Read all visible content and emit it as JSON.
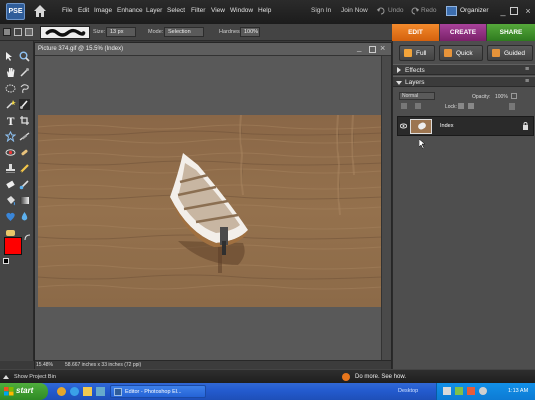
{
  "app": {
    "logo_text": "PSE"
  },
  "menu": [
    "File",
    "Edit",
    "Image",
    "Enhance",
    "Layer",
    "Select",
    "Filter",
    "View",
    "Window",
    "Help"
  ],
  "top_links": {
    "sign_in": "Sign In",
    "join_now": "Join Now",
    "undo": "Undo",
    "redo": "Redo",
    "organizer": "Organizer"
  },
  "options_bar": {
    "size_label": "Size:",
    "size_value": "13 px",
    "mode_label": "Mode:",
    "mode_value": "Selection",
    "hardness_label": "Hardness:",
    "hardness_value": "100%"
  },
  "mode_tabs": [
    {
      "label": "EDIT",
      "color": "#e2701b"
    },
    {
      "label": "CREATE",
      "color": "#8a2c7a"
    },
    {
      "label": "SHARE",
      "color": "#3f8a2a"
    }
  ],
  "edit_tabs": {
    "full": "Full",
    "quick": "Quick",
    "guided": "Guided"
  },
  "document": {
    "title": "Picture 374.gif @ 15.5% (Index)",
    "zoom": "15.48%",
    "info": "58.667 inches x 33 inches (72 ppi)"
  },
  "panels": {
    "effects": "Effects",
    "layers": "Layers",
    "blend_mode": "Normal",
    "opacity_label": "Opacity:",
    "opacity_value": "100%",
    "lock_label": "Lock:",
    "layer_name": "Index"
  },
  "bottom": {
    "project_bin": "Show Project Bin",
    "do_more": "Do more. See how."
  },
  "taskbar": {
    "start": "start",
    "task": "Editor - Photoshop El...",
    "desktop": "Desktop",
    "time": "1:13 AM"
  },
  "colors": {
    "foreground": "#ff0000",
    "background": "#ffffff",
    "accent_edit": "#e2701b"
  }
}
